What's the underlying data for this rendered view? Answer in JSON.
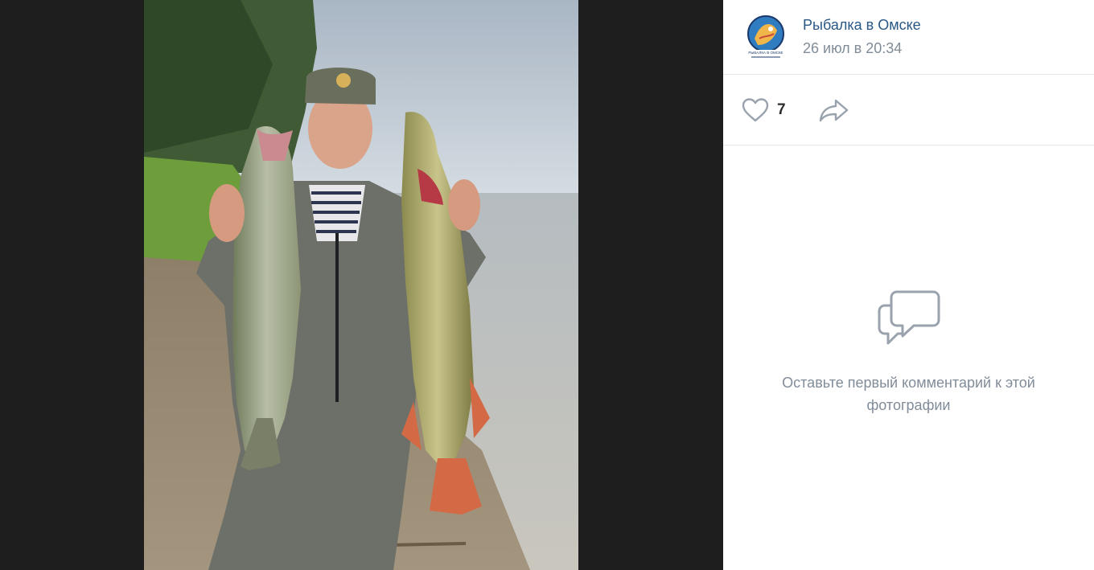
{
  "post": {
    "author_name": "Рыбалка в Омске",
    "date": "26 июл в 20:34",
    "avatar_text": "РЫБАЛКА В ОМСКЕ"
  },
  "actions": {
    "like_count": "7"
  },
  "comments": {
    "empty_text": "Оставьте первый комментарий к этой фотографии"
  },
  "colors": {
    "link": "#2a5885",
    "secondary": "#818c99",
    "icon": "#99a2ad",
    "divider": "#e7e8ec",
    "backdrop": "#1e1e1e"
  },
  "icons": [
    "heart-icon",
    "share-arrow-icon",
    "comment-bubbles-icon"
  ]
}
